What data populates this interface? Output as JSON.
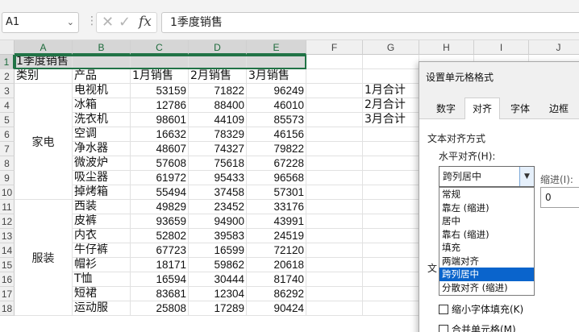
{
  "formula_bar": {
    "name_box": "A1",
    "formula": "1季度销售",
    "fx_label": "fx",
    "separator": "⋮"
  },
  "grid": {
    "columns": [
      "A",
      "B",
      "C",
      "D",
      "E",
      "F",
      "G",
      "H",
      "I",
      "J"
    ],
    "rows": [
      "1",
      "2",
      "3",
      "4",
      "5",
      "6",
      "7",
      "8",
      "9",
      "10",
      "11",
      "12",
      "13",
      "14",
      "15",
      "16",
      "17",
      "18"
    ],
    "title": "1季度销售",
    "headers": [
      "类别",
      "产品",
      "1月销售",
      "2月销售",
      "3月销售"
    ],
    "categories": [
      {
        "name": "家电",
        "products": [
          [
            "电视机",
            53159,
            71822,
            96249
          ],
          [
            "冰箱",
            12786,
            88400,
            46010
          ],
          [
            "洗衣机",
            98601,
            44109,
            85573
          ],
          [
            "空调",
            16632,
            78329,
            46156
          ],
          [
            "净水器",
            48607,
            74327,
            79822
          ],
          [
            "微波炉",
            57608,
            75618,
            67228
          ],
          [
            "吸尘器",
            61972,
            95433,
            96568
          ],
          [
            "掉烤箱",
            55494,
            37458,
            57301
          ]
        ]
      },
      {
        "name": "服装",
        "products": [
          [
            "西装",
            49829,
            23452,
            33176
          ],
          [
            "皮裤",
            93659,
            94900,
            43991
          ],
          [
            "内衣",
            52802,
            39583,
            24519
          ],
          [
            "牛仔裤",
            67723,
            16599,
            72120
          ],
          [
            "帽衫",
            18171,
            59862,
            20618
          ],
          [
            "T恤",
            16594,
            30444,
            81740
          ],
          [
            "短裙",
            83681,
            12304,
            86292
          ],
          [
            "运动服",
            25808,
            17289,
            90424
          ]
        ]
      }
    ],
    "totals": [
      "1月合计",
      "2月合计",
      "3月合计"
    ]
  },
  "dialog": {
    "title": "设置单元格格式",
    "tabs": [
      "数字",
      "对齐",
      "字体",
      "边框"
    ],
    "active_tab": "对齐",
    "section_text_align": "文本对齐方式",
    "horizontal_label": "水平对齐(H):",
    "horizontal_value": "跨列居中",
    "indent_label": "缩进(I):",
    "indent_value": "0",
    "horizontal_options": [
      "常规",
      "靠左 (缩进)",
      "居中",
      "靠右 (缩进)",
      "填充",
      "两端对齐",
      "跨列居中",
      "分散对齐 (缩进)"
    ],
    "highlighted_option": "跨列居中",
    "section_text_control_partial": "文",
    "checkbox_shrink": "缩小字体填充(K)",
    "checkbox_merge": "合并单元格(M)"
  },
  "colors": {
    "selection_border": "#217346",
    "list_highlight": "#0a64cc"
  }
}
